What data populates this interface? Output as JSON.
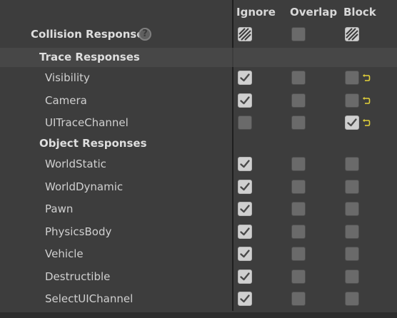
{
  "header": {
    "ignore": "Ignore",
    "overlap": "Overlap",
    "block": "Block"
  },
  "collision_responses": {
    "label": "Collision Responses",
    "help_glyph": "?",
    "ignore": "mixed",
    "overlap": "unchecked",
    "block": "mixed"
  },
  "trace_responses": {
    "label": "Trace Responses",
    "rows": [
      {
        "label": "Visibility",
        "ignore": "checked",
        "overlap": "unchecked",
        "block": "unchecked",
        "reset": true
      },
      {
        "label": "Camera",
        "ignore": "checked",
        "overlap": "unchecked",
        "block": "unchecked",
        "reset": true
      },
      {
        "label": "UITraceChannel",
        "ignore": "unchecked",
        "overlap": "unchecked",
        "block": "checked",
        "reset": true
      }
    ]
  },
  "object_responses": {
    "label": "Object Responses",
    "rows": [
      {
        "label": "WorldStatic",
        "ignore": "checked",
        "overlap": "unchecked",
        "block": "unchecked",
        "reset": false
      },
      {
        "label": "WorldDynamic",
        "ignore": "checked",
        "overlap": "unchecked",
        "block": "unchecked",
        "reset": false
      },
      {
        "label": "Pawn",
        "ignore": "checked",
        "overlap": "unchecked",
        "block": "unchecked",
        "reset": false
      },
      {
        "label": "PhysicsBody",
        "ignore": "checked",
        "overlap": "unchecked",
        "block": "unchecked",
        "reset": false
      },
      {
        "label": "Vehicle",
        "ignore": "checked",
        "overlap": "unchecked",
        "block": "unchecked",
        "reset": false
      },
      {
        "label": "Destructible",
        "ignore": "checked",
        "overlap": "unchecked",
        "block": "unchecked",
        "reset": false
      },
      {
        "label": "SelectUIChannel",
        "ignore": "checked",
        "overlap": "unchecked",
        "block": "unchecked",
        "reset": false
      }
    ]
  },
  "icons": {
    "reset": "reset-to-default-arrow-icon",
    "help": "help-icon"
  },
  "colors": {
    "background": "#3d3d3d",
    "section_band": "#474747",
    "divider": "#1f1f1f",
    "reset_arrow": "#e3d23a"
  }
}
